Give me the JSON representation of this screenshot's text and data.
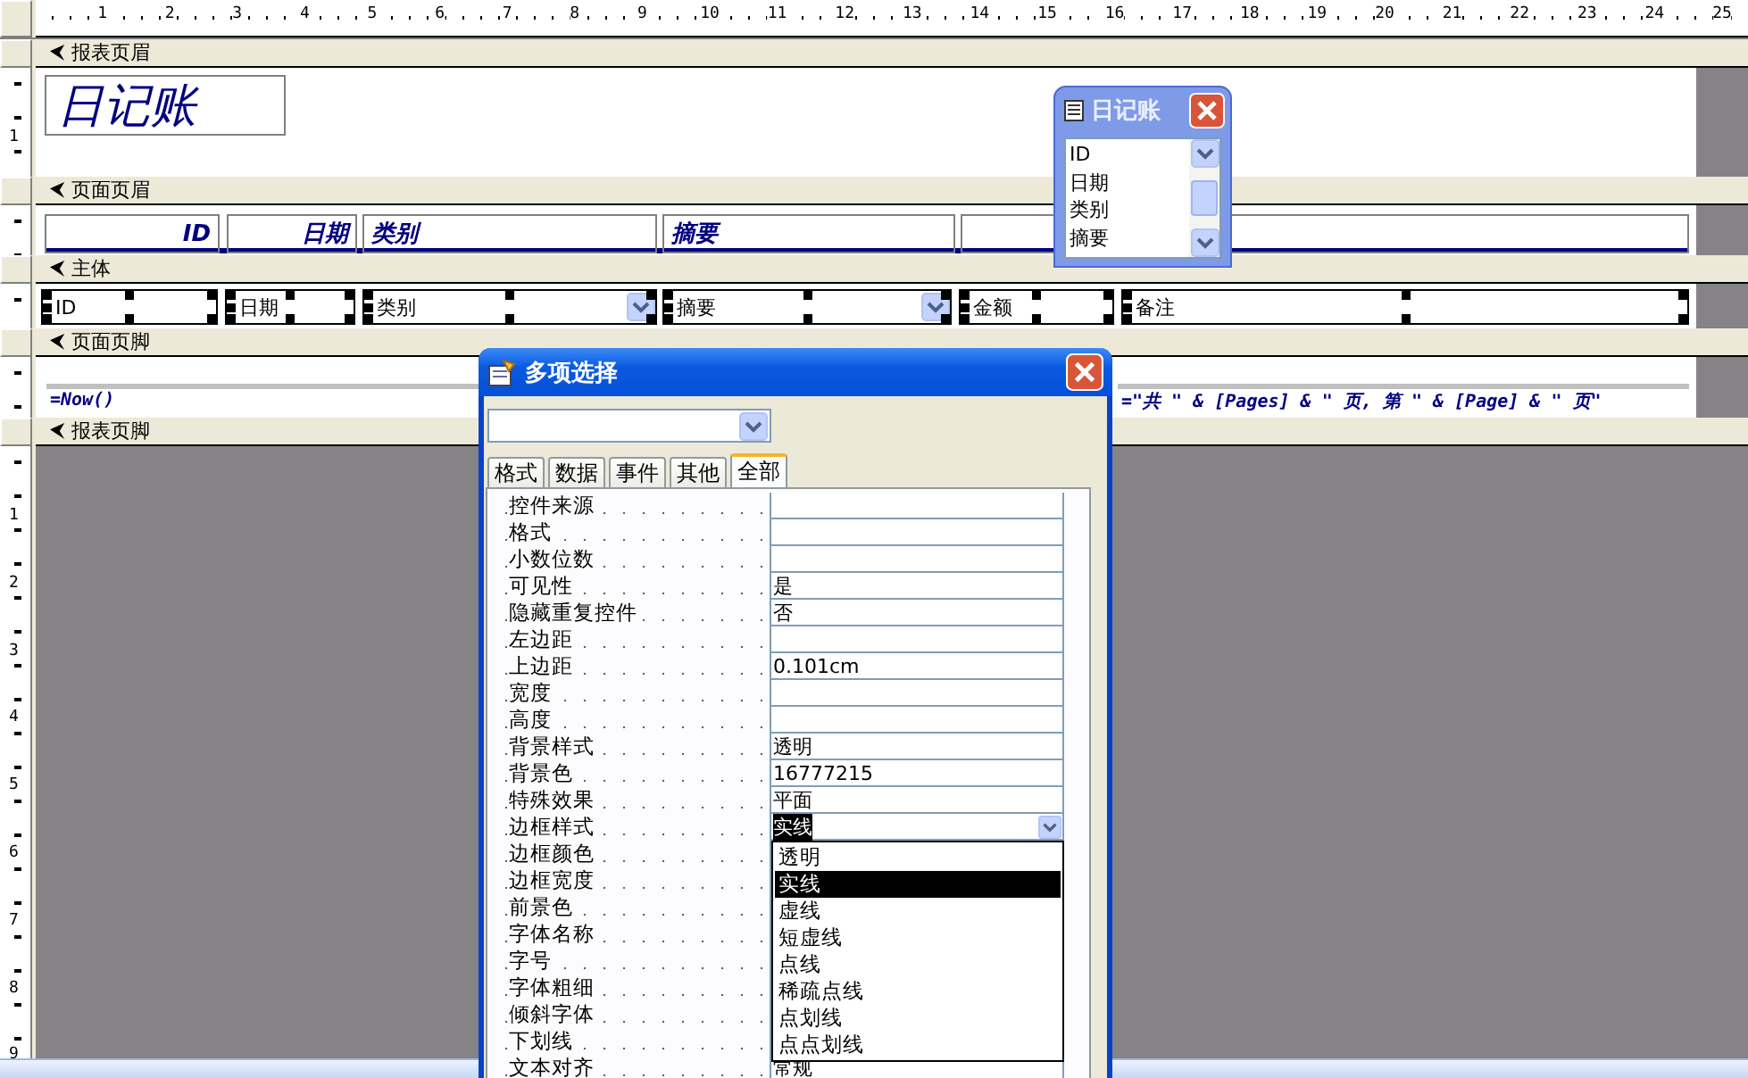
{
  "ruler": {
    "horizontal": [
      "1",
      "2",
      "3",
      "4",
      "5",
      "6",
      "7",
      "8",
      "9",
      "10",
      "11",
      "12",
      "13",
      "14",
      "15",
      "16",
      "17",
      "18",
      "19",
      "20",
      "21",
      "22",
      "23",
      "24",
      "25"
    ]
  },
  "sections": [
    {
      "title": "报表页眉",
      "ruler": [
        "1"
      ],
      "controls": [
        {
          "kind": "title_label",
          "text": "日记账",
          "selected": false
        }
      ]
    },
    {
      "title": "页面页眉",
      "controls": [
        {
          "kind": "label",
          "text": "ID",
          "selected": false
        },
        {
          "kind": "label",
          "text": "日期",
          "selected": false
        },
        {
          "kind": "label",
          "text": "类别",
          "selected": false
        },
        {
          "kind": "label",
          "text": "摘要",
          "selected": false
        },
        {
          "kind": "box",
          "selected": false
        }
      ]
    },
    {
      "title": "主体",
      "controls": [
        {
          "kind": "textbox",
          "text": "ID",
          "selected": true
        },
        {
          "kind": "textbox",
          "text": "日期",
          "selected": true
        },
        {
          "kind": "combobox",
          "text": "类别",
          "selected": true
        },
        {
          "kind": "combobox",
          "text": "摘要",
          "selected": true
        },
        {
          "kind": "textbox",
          "text": "金额",
          "selected": true
        },
        {
          "kind": "textbox",
          "text": "备注",
          "selected": true
        }
      ]
    },
    {
      "title": "页面页脚",
      "controls": [
        {
          "kind": "expression",
          "text": "=Now()",
          "selected": false
        },
        {
          "kind": "expression",
          "text": "=\"共 \" & [Pages] & \" 页, 第 \" & [Page] & \" 页\"",
          "selected": false
        }
      ]
    },
    {
      "title": "报表页脚",
      "ruler": [
        "1",
        "2",
        "3",
        "4",
        "5",
        "6",
        "7",
        "8",
        "9"
      ]
    }
  ],
  "field_list": {
    "title": "日记账",
    "items": [
      "ID",
      "日期",
      "类别",
      "摘要"
    ]
  },
  "property_sheet": {
    "title": "多项选择",
    "tabs": [
      {
        "label": "格式",
        "selected": false
      },
      {
        "label": "数据",
        "selected": false
      },
      {
        "label": "事件",
        "selected": false
      },
      {
        "label": "其他",
        "selected": false
      },
      {
        "label": "全部",
        "selected": true
      }
    ],
    "properties": [
      {
        "name": "控件来源"
      },
      {
        "name": "格式"
      },
      {
        "name": "小数位数"
      },
      {
        "name": "可见性",
        "value": "是"
      },
      {
        "name": "隐藏重复控件",
        "value": "否"
      },
      {
        "name": "左边距"
      },
      {
        "name": "上边距",
        "value": "0.101cm"
      },
      {
        "name": "宽度"
      },
      {
        "name": "高度"
      },
      {
        "name": "背景样式",
        "value": "透明"
      },
      {
        "name": "背景色",
        "value": "16777215"
      },
      {
        "name": "特殊效果",
        "value": "平面"
      },
      {
        "name": "边框样式",
        "value": "实线",
        "active": true,
        "options": [
          {
            "label": "透明",
            "selected": false
          },
          {
            "label": "实线",
            "selected": true
          },
          {
            "label": "虚线",
            "selected": false
          },
          {
            "label": "短虚线",
            "selected": false
          },
          {
            "label": "点线",
            "selected": false
          },
          {
            "label": "稀疏点线",
            "selected": false
          },
          {
            "label": "点划线",
            "selected": false
          },
          {
            "label": "点点划线",
            "selected": false
          }
        ]
      },
      {
        "name": "边框颜色"
      },
      {
        "name": "边框宽度"
      },
      {
        "name": "前景色"
      },
      {
        "name": "字体名称"
      },
      {
        "name": "字号"
      },
      {
        "name": "字体粗细"
      },
      {
        "name": "倾斜字体"
      },
      {
        "name": "下划线"
      },
      {
        "name": "文本对齐",
        "value": "常规"
      }
    ]
  }
}
